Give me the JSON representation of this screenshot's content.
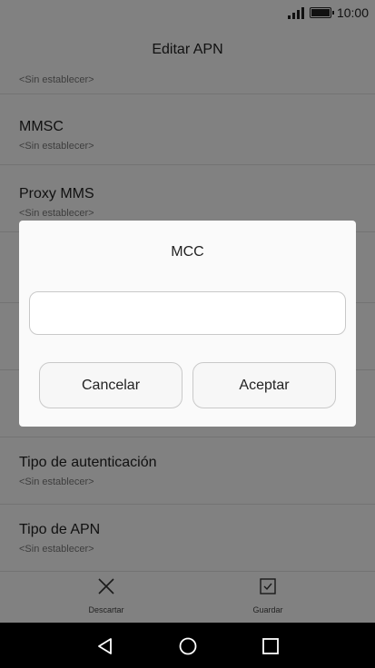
{
  "status_bar": {
    "time": "10:00",
    "signal_icon": "signal-icon",
    "battery_icon": "battery-icon"
  },
  "app": {
    "title": "Editar APN"
  },
  "list": {
    "partial_top_sub": "<Sin establecer>",
    "items": [
      {
        "title": "MMSC",
        "value": "<Sin establecer>"
      },
      {
        "title": "Proxy MMS",
        "value": "<Sin establecer>"
      },
      {
        "title": "Tipo de autenticación",
        "value": "<Sin establecer>"
      },
      {
        "title": "Tipo de APN",
        "value": "<Sin establecer>"
      }
    ]
  },
  "bottom_bar": {
    "discard_label": "Descartar",
    "save_label": "Guardar"
  },
  "dialog": {
    "title": "MCC",
    "input_value": "",
    "cancel_label": "Cancelar",
    "accept_label": "Aceptar"
  }
}
